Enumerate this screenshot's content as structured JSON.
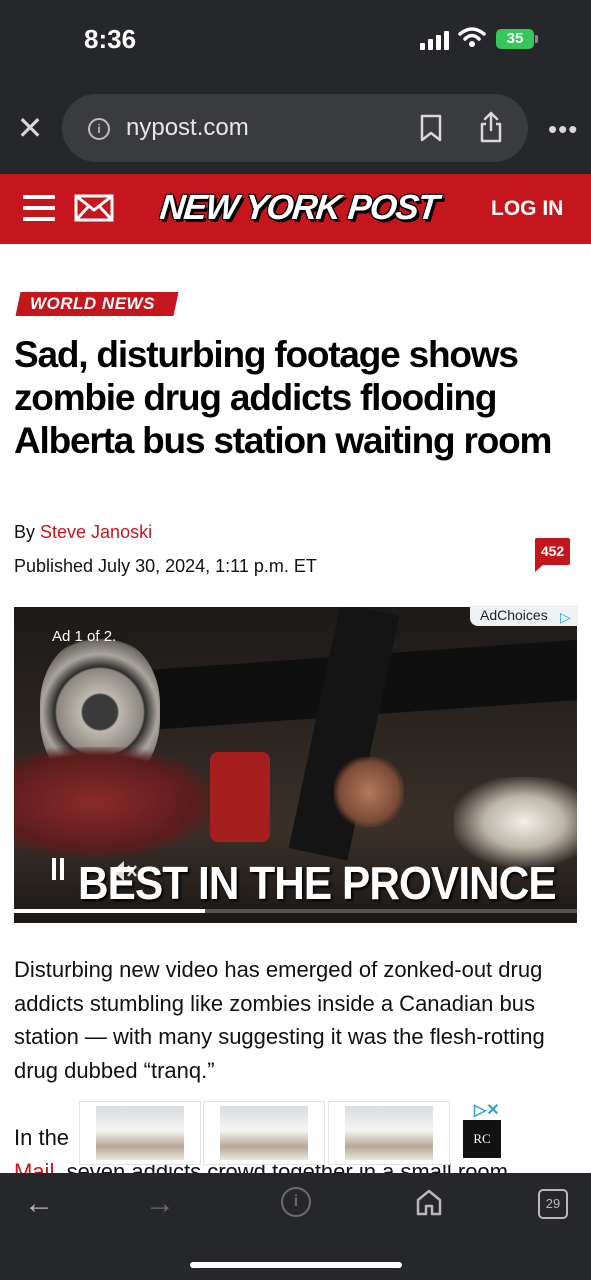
{
  "status_bar": {
    "time": "8:36",
    "battery": "35"
  },
  "browser": {
    "url": "nypost.com",
    "close_glyph": "✕",
    "more_glyph": "•••",
    "tab_count": "29"
  },
  "site": {
    "logo": "NEW YORK POST",
    "login": "LOG IN"
  },
  "article": {
    "category": "WORLD NEWS",
    "headline": "Sad, disturbing footage shows zombie drug addicts flooding Alberta bus station waiting room",
    "byline_prefix": "By ",
    "author": "Steve Janoski",
    "published": "Published July 30, 2024, 1:11 p.m. ET",
    "comment_count": "452",
    "paragraph1": "Disturbing new video has emerged of zonked-out drug addicts stumbling like zombies inside a Canadian bus station — with many suggesting it was the flesh-rotting drug dubbed “tranq.”",
    "paragraph2_start": "In the",
    "paragraph2_link_end": "y",
    "paragraph2_line2_link": "Mail",
    "paragraph2_line2_rest": ", seven addicts crowd together in a small room"
  },
  "video_ad": {
    "counter": "Ad 1 of 2.",
    "adchoices": "AdChoices",
    "caption": "BEST IN THE PROVINCE",
    "progress": 0.34
  },
  "banner_ad": {
    "brand_mark": "RC"
  },
  "colors": {
    "brand_red": "#c4161c",
    "chrome_dark": "#26272b",
    "battery_green": "#35c759",
    "adchoices_blue": "#2ea3d6"
  }
}
